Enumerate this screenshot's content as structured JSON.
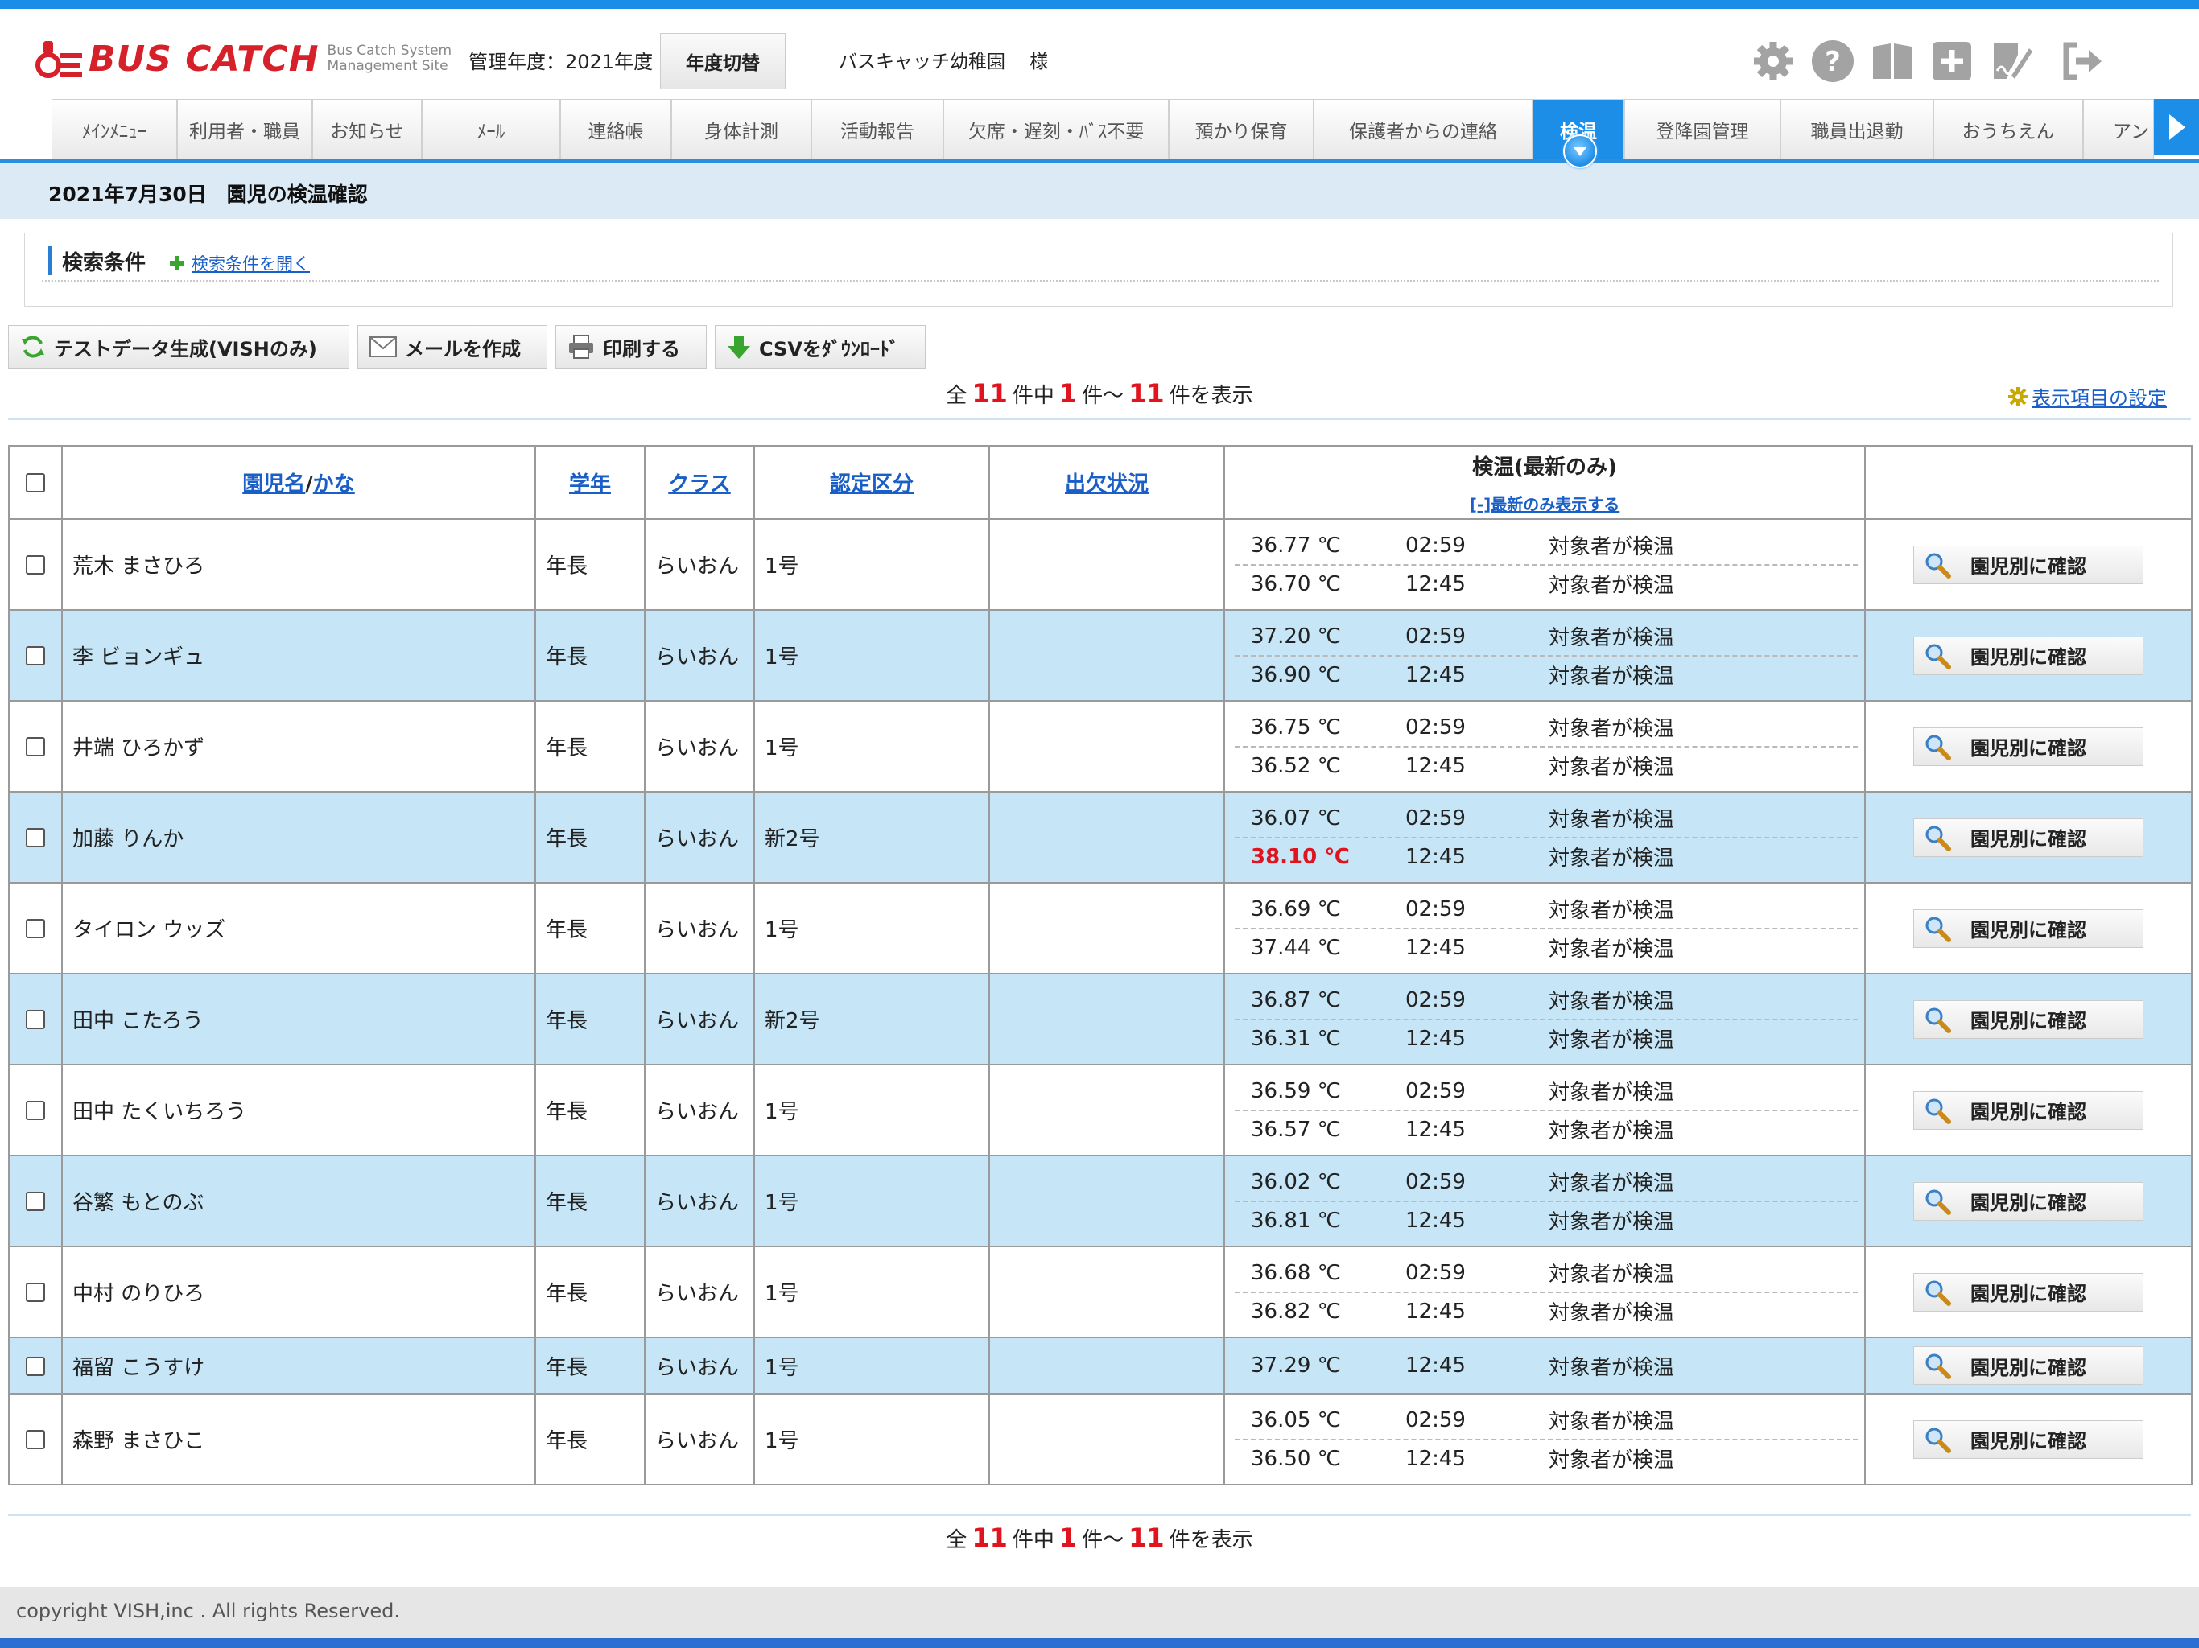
{
  "header": {
    "logo_text": "BUS CATCH",
    "logo_sub": "Bus Catch System Management Site",
    "fiscal_year": "管理年度：2021年度",
    "year_switch": "年度切替",
    "school": "バスキャッチ幼稚園　 様",
    "icons": [
      "gear-icon",
      "help-icon",
      "manual-book-icon",
      "add-icon",
      "signature-icon",
      "logout-icon"
    ]
  },
  "nav": {
    "tabs": [
      "ﾒｲﾝﾒﾆｭｰ",
      "利用者・職員",
      "お知らせ",
      "ﾒｰﾙ",
      "連絡帳",
      "身体計測",
      "活動報告",
      "欠席・遅刻・ﾊﾞｽ不要",
      "預かり保育",
      "保護者からの連絡",
      "検温",
      "登降園管理",
      "職員出退勤",
      "おうちえん",
      "アン"
    ],
    "active": "検温"
  },
  "page": {
    "title": "2021年7月30日　園児の検温確認",
    "search_title": "検索条件",
    "search_open": "検索条件を開く"
  },
  "actions": {
    "test_data": "テストデータ生成(VISHのみ)",
    "mail": "メールを作成",
    "print": "印刷する",
    "csv": "CSVをﾀﾞｳﾝﾛｰﾄﾞ"
  },
  "count": {
    "prefix": "全",
    "total": "11",
    "mid1": "件中",
    "from": "1",
    "mid2": "件～",
    "to": "11",
    "suffix": "件を表示"
  },
  "settings_link": "表示項目の設定",
  "table": {
    "headers": {
      "name": "園児名",
      "slash": "/",
      "kana": "かな",
      "grade": "学年",
      "class": "クラス",
      "cert": "認定区分",
      "attendance": "出欠状況",
      "temp": "検温(最新のみ)",
      "temp_toggle": "[-]最新のみ表示する"
    },
    "confirm_label": "園児別に確認",
    "rows": [
      {
        "name": "荒木 まさひろ",
        "grade": "年長",
        "class": "らいおん",
        "cert": "1号",
        "attendance": "",
        "temps": [
          {
            "value": "36.77 ℃",
            "time": "02:59",
            "status": "対象者が検温"
          },
          {
            "value": "36.70 ℃",
            "time": "12:45",
            "status": "対象者が検温"
          }
        ]
      },
      {
        "name": "李 ビョンギュ",
        "grade": "年長",
        "class": "らいおん",
        "cert": "1号",
        "attendance": "",
        "temps": [
          {
            "value": "37.20 ℃",
            "time": "02:59",
            "status": "対象者が検温"
          },
          {
            "value": "36.90 ℃",
            "time": "12:45",
            "status": "対象者が検温"
          }
        ]
      },
      {
        "name": "井端 ひろかず",
        "grade": "年長",
        "class": "らいおん",
        "cert": "1号",
        "attendance": "",
        "temps": [
          {
            "value": "36.75 ℃",
            "time": "02:59",
            "status": "対象者が検温"
          },
          {
            "value": "36.52 ℃",
            "time": "12:45",
            "status": "対象者が検温"
          }
        ]
      },
      {
        "name": "加藤 りんか",
        "grade": "年長",
        "class": "らいおん",
        "cert": "新2号",
        "attendance": "",
        "temps": [
          {
            "value": "36.07 ℃",
            "time": "02:59",
            "status": "対象者が検温"
          },
          {
            "value": "38.10 ℃",
            "time": "12:45",
            "status": "対象者が検温",
            "fever": true
          }
        ]
      },
      {
        "name": "タイロン ウッズ",
        "grade": "年長",
        "class": "らいおん",
        "cert": "1号",
        "attendance": "",
        "temps": [
          {
            "value": "36.69 ℃",
            "time": "02:59",
            "status": "対象者が検温"
          },
          {
            "value": "37.44 ℃",
            "time": "12:45",
            "status": "対象者が検温"
          }
        ]
      },
      {
        "name": "田中 こたろう",
        "grade": "年長",
        "class": "らいおん",
        "cert": "新2号",
        "attendance": "",
        "temps": [
          {
            "value": "36.87 ℃",
            "time": "02:59",
            "status": "対象者が検温"
          },
          {
            "value": "36.31 ℃",
            "time": "12:45",
            "status": "対象者が検温"
          }
        ]
      },
      {
        "name": "田中 たくいちろう",
        "grade": "年長",
        "class": "らいおん",
        "cert": "1号",
        "attendance": "",
        "temps": [
          {
            "value": "36.59 ℃",
            "time": "02:59",
            "status": "対象者が検温"
          },
          {
            "value": "36.57 ℃",
            "time": "12:45",
            "status": "対象者が検温"
          }
        ]
      },
      {
        "name": "谷繁 もとのぶ",
        "grade": "年長",
        "class": "らいおん",
        "cert": "1号",
        "attendance": "",
        "temps": [
          {
            "value": "36.02 ℃",
            "time": "02:59",
            "status": "対象者が検温"
          },
          {
            "value": "36.81 ℃",
            "time": "12:45",
            "status": "対象者が検温"
          }
        ]
      },
      {
        "name": "中村 のりひろ",
        "grade": "年長",
        "class": "らいおん",
        "cert": "1号",
        "attendance": "",
        "temps": [
          {
            "value": "36.68 ℃",
            "time": "02:59",
            "status": "対象者が検温"
          },
          {
            "value": "36.82 ℃",
            "time": "12:45",
            "status": "対象者が検温"
          }
        ]
      },
      {
        "name": "福留 こうすけ",
        "grade": "年長",
        "class": "らいおん",
        "cert": "1号",
        "attendance": "",
        "temps": [
          {
            "value": "37.29 ℃",
            "time": "12:45",
            "status": "対象者が検温"
          }
        ]
      },
      {
        "name": "森野 まさひこ",
        "grade": "年長",
        "class": "らいおん",
        "cert": "1号",
        "attendance": "",
        "temps": [
          {
            "value": "36.05 ℃",
            "time": "02:59",
            "status": "対象者が検温"
          },
          {
            "value": "36.50 ℃",
            "time": "12:45",
            "status": "対象者が検温"
          }
        ]
      }
    ]
  },
  "footer": {
    "copyright": "copyright VISH,inc . All rights Reserved."
  },
  "colors": {
    "accent": "#1d8ee8",
    "alt_row": "#c6e6f7",
    "fever": "#e0141e",
    "logo": "#d6202a"
  }
}
